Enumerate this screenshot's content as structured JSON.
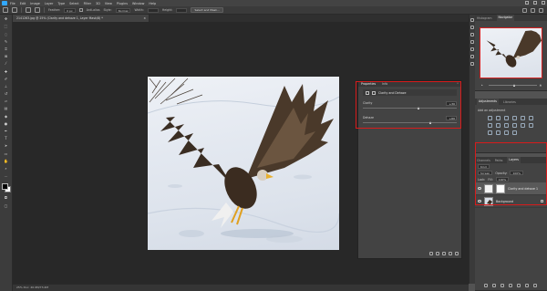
{
  "menubar": {
    "items": [
      "File",
      "Edit",
      "Image",
      "Layer",
      "Type",
      "Select",
      "Filter",
      "3D",
      "View",
      "Plugins",
      "Window",
      "Help"
    ]
  },
  "options_bar": {
    "feather_label": "Feather:",
    "feather_value": "0 px",
    "antialias_label": "Anti-alias",
    "style_label": "Style:",
    "style_value": "Normal",
    "width_label": "Width:",
    "height_label": "Height:",
    "select_mask_label": "Select and Mask..."
  },
  "document": {
    "tab_title": "2141263.jpg @ 25% (Clarity and dehaze 1, Layer Mask/8) *",
    "close_glyph": "×"
  },
  "status_bar": {
    "text": "25%     Doc: 40.9M/73.4M"
  },
  "properties_panel": {
    "tab_active": "Properties",
    "tab_info": "Info",
    "collapse_glyph": "«",
    "header_label": "Clarity and Dehaze",
    "sliders": [
      {
        "label": "Clarity",
        "value": "+30",
        "fraction": 0.6
      },
      {
        "label": "Dehaze",
        "value": "+60",
        "fraction": 0.72
      }
    ]
  },
  "navigator_panel": {
    "tab_histogram": "Histogram",
    "tab_navigator": "Navigator",
    "zoom_fraction": 0.5
  },
  "adjustments_panel": {
    "tab_adjustments": "Adjustments",
    "tab_libraries": "Libraries",
    "hint": "Add an adjustment"
  },
  "layers_panel": {
    "tab_channels": "Channels",
    "tab_paths": "Paths",
    "tab_layers": "Layers",
    "kind_label": "Kind",
    "blend_mode": "Screen",
    "opacity_label": "Opacity:",
    "opacity_value": "100%",
    "lock_label": "Lock:",
    "fill_label": "Fill:",
    "fill_value": "100%",
    "layers": [
      {
        "name": "Clarity and dehaze 1",
        "selected": true
      },
      {
        "name": "Background",
        "selected": false
      }
    ]
  },
  "colors": {
    "highlight": "#d81b1b",
    "accent": "#31a8ff"
  }
}
